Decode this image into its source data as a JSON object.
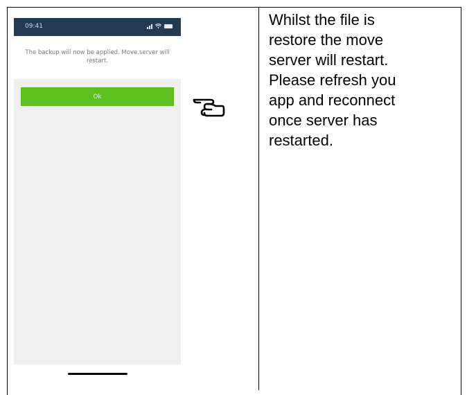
{
  "phone": {
    "status_time": "09:41",
    "icons": [
      "signal-icon",
      "wifi-icon",
      "battery-icon"
    ],
    "message": "The backup will now be applied. Move.server will restart.",
    "ok_label": "Ok",
    "colors": {
      "status_bar": "#243a52",
      "button": "#5cbf1f",
      "background": "#efefef"
    }
  },
  "pointer_icon": "pointing-hand-icon",
  "instructions": "Whilst the file is\nrestore the move\nserver will restart.\nPlease refresh you\napp and reconnect\nonce server has\nrestarted."
}
